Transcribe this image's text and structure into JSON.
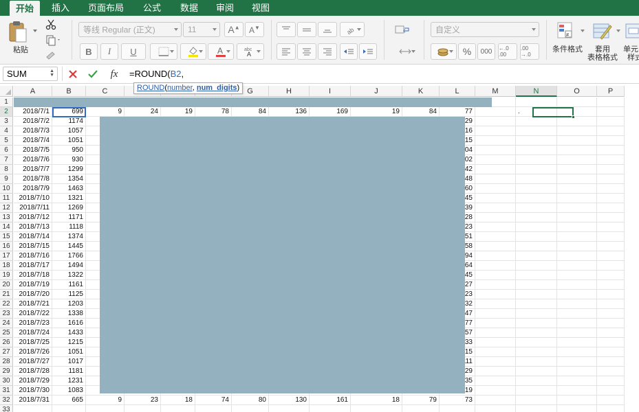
{
  "tabs": [
    "开始",
    "插入",
    "页面布局",
    "公式",
    "数据",
    "审阅",
    "视图"
  ],
  "active_tab_index": 0,
  "ribbon": {
    "paste_label": "粘贴",
    "font_name": "等线 Regular (正文)",
    "font_size": "11",
    "bold": "B",
    "italic": "I",
    "underline": "U",
    "number_format": "自定义",
    "percent": "%",
    "thousands": "000",
    "inc_decimal": "←.0 .00",
    "dec_decimal": ".00 →.0",
    "conditional_format": "条件格式",
    "table_format_line1": "套用",
    "table_format_line2": "表格格式",
    "cell_styles_line1": "单元",
    "cell_styles_line2": "样式"
  },
  "formula_bar": {
    "name_box": "SUM",
    "formula_prefix": "=ROUND(",
    "formula_ref": "B2",
    "formula_suffix": ","
  },
  "tooltip": {
    "func": "ROUND",
    "open": "(",
    "arg1": "number",
    "comma": ", ",
    "arg2": "num_digits",
    "close": ")"
  },
  "columns": [
    "A",
    "B",
    "C",
    "D",
    "E",
    "F",
    "G",
    "H",
    "I",
    "J",
    "K",
    "L",
    "M",
    "N",
    "O",
    "P"
  ],
  "rows": [
    [
      "",
      "",
      "",
      "",
      "",
      "",
      "",
      "",
      "",
      "",
      "",
      ""
    ],
    [
      "2018/7/1",
      "699",
      "9",
      "24",
      "19",
      "78",
      "84",
      "136",
      "169",
      "19",
      "84",
      "77"
    ],
    [
      "2018/7/2",
      "1174",
      "",
      "",
      "",
      "",
      "",
      "",
      "",
      "",
      "",
      "129"
    ],
    [
      "2018/7/3",
      "1057",
      "",
      "",
      "",
      "",
      "",
      "",
      "",
      "",
      "",
      "116"
    ],
    [
      "2018/7/4",
      "1051",
      "",
      "",
      "",
      "",
      "",
      "",
      "",
      "",
      "",
      "115"
    ],
    [
      "2018/7/5",
      "950",
      "",
      "",
      "",
      "",
      "",
      "",
      "",
      "",
      "",
      "104"
    ],
    [
      "2018/7/6",
      "930",
      "",
      "",
      "",
      "",
      "",
      "",
      "",
      "",
      "",
      "102"
    ],
    [
      "2018/7/7",
      "1299",
      "",
      "",
      "",
      "",
      "",
      "",
      "",
      "",
      "",
      "142"
    ],
    [
      "2018/7/8",
      "1354",
      "",
      "",
      "",
      "",
      "",
      "",
      "",
      "",
      "",
      "148"
    ],
    [
      "2018/7/9",
      "1463",
      "",
      "",
      "",
      "",
      "",
      "",
      "",
      "",
      "",
      "160"
    ],
    [
      "2018/7/10",
      "1321",
      "",
      "",
      "",
      "",
      "",
      "",
      "",
      "",
      "",
      "145"
    ],
    [
      "2018/7/11",
      "1269",
      "",
      "",
      "",
      "",
      "",
      "",
      "",
      "",
      "",
      "139"
    ],
    [
      "2018/7/12",
      "1171",
      "",
      "",
      "",
      "",
      "",
      "",
      "",
      "",
      "",
      "128"
    ],
    [
      "2018/7/13",
      "1118",
      "",
      "",
      "",
      "",
      "",
      "",
      "",
      "",
      "",
      "123"
    ],
    [
      "2018/7/14",
      "1374",
      "",
      "",
      "",
      "",
      "",
      "",
      "",
      "",
      "",
      "151"
    ],
    [
      "2018/7/15",
      "1445",
      "",
      "",
      "",
      "",
      "",
      "",
      "",
      "",
      "",
      "158"
    ],
    [
      "2018/7/16",
      "1766",
      "",
      "",
      "",
      "",
      "",
      "",
      "",
      "",
      "",
      "194"
    ],
    [
      "2018/7/17",
      "1494",
      "",
      "",
      "",
      "",
      "",
      "",
      "",
      "",
      "",
      "164"
    ],
    [
      "2018/7/18",
      "1322",
      "",
      "",
      "",
      "",
      "",
      "",
      "",
      "",
      "",
      "145"
    ],
    [
      "2018/7/19",
      "1161",
      "",
      "",
      "",
      "",
      "",
      "",
      "",
      "",
      "",
      "127"
    ],
    [
      "2018/7/20",
      "1125",
      "",
      "",
      "",
      "",
      "",
      "",
      "",
      "",
      "",
      "123"
    ],
    [
      "2018/7/21",
      "1203",
      "",
      "",
      "",
      "",
      "",
      "",
      "",
      "",
      "",
      "132"
    ],
    [
      "2018/7/22",
      "1338",
      "",
      "",
      "",
      "",
      "",
      "",
      "",
      "",
      "",
      "147"
    ],
    [
      "2018/7/23",
      "1616",
      "",
      "",
      "",
      "",
      "",
      "",
      "",
      "",
      "",
      "177"
    ],
    [
      "2018/7/24",
      "1433",
      "",
      "",
      "",
      "",
      "",
      "",
      "",
      "",
      "",
      "157"
    ],
    [
      "2018/7/25",
      "1215",
      "",
      "",
      "",
      "",
      "",
      "",
      "",
      "",
      "",
      "133"
    ],
    [
      "2018/7/26",
      "1051",
      "",
      "",
      "",
      "",
      "",
      "",
      "",
      "",
      "",
      "115"
    ],
    [
      "2018/7/27",
      "1017",
      "",
      "",
      "",
      "",
      "",
      "",
      "",
      "",
      "",
      "111"
    ],
    [
      "2018/7/28",
      "1181",
      "",
      "",
      "",
      "",
      "",
      "",
      "",
      "",
      "",
      "129"
    ],
    [
      "2018/7/29",
      "1231",
      "",
      "",
      "",
      "",
      "",
      "",
      "",
      "",
      "",
      "135"
    ],
    [
      "2018/7/30",
      "1083",
      "",
      "",
      "",
      "",
      "",
      "",
      "",
      "",
      "",
      "119"
    ],
    [
      "2018/7/31",
      "665",
      "9",
      "23",
      "18",
      "74",
      "80",
      "130",
      "161",
      "18",
      "79",
      "73"
    ],
    [
      "",
      "",
      "",
      "",
      "",
      "",
      "",
      "",
      "",
      "",
      "",
      ""
    ]
  ],
  "active_cell": "N2",
  "active_cell_value": ".",
  "referenced_cell": "B2",
  "colors": {
    "brand_green": "#217346",
    "redacted_fill": "#94b1c0",
    "ref_blue": "#2f6bbf"
  }
}
